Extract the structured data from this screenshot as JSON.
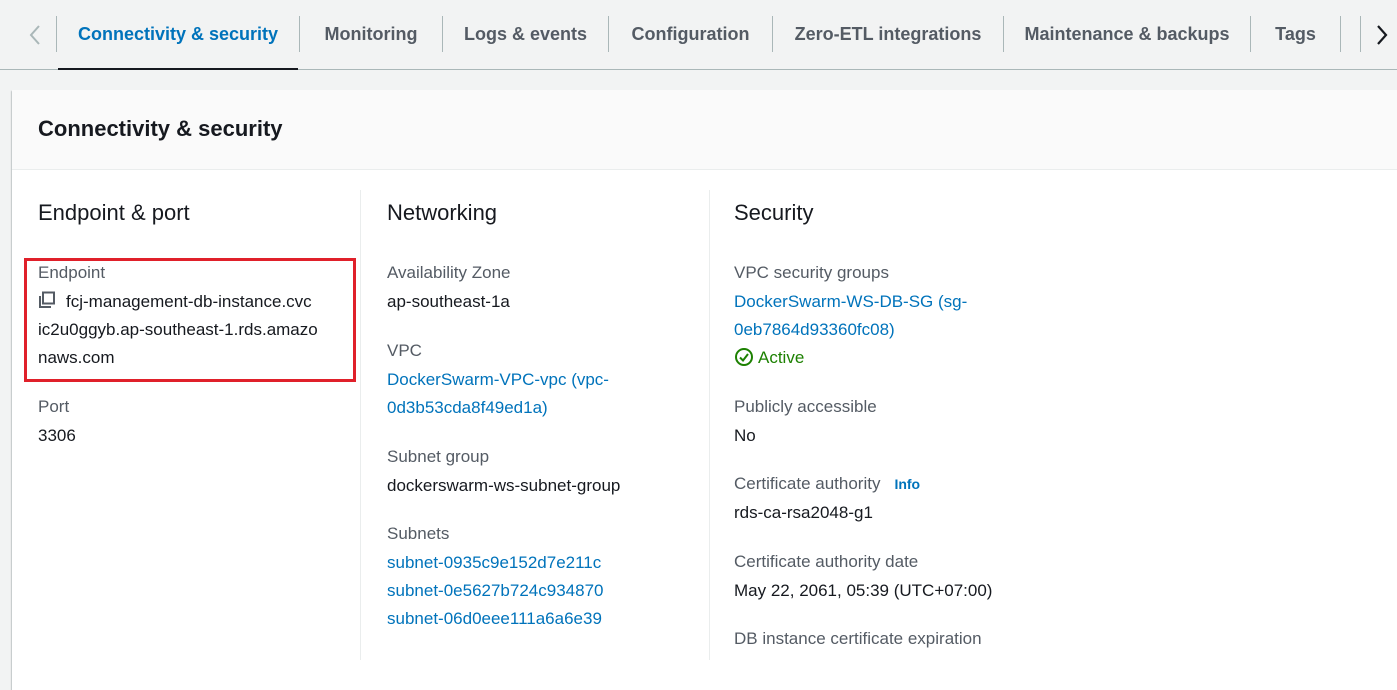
{
  "tabs": {
    "items": [
      {
        "label": "Connectivity & security"
      },
      {
        "label": "Monitoring"
      },
      {
        "label": "Logs & events"
      },
      {
        "label": "Configuration"
      },
      {
        "label": "Zero-ETL integrations"
      },
      {
        "label": "Maintenance & backups"
      },
      {
        "label": "Tags"
      }
    ],
    "active_index": 0
  },
  "panel": {
    "title": "Connectivity & security",
    "endpoint_port": {
      "title": "Endpoint & port",
      "endpoint_label": "Endpoint",
      "endpoint_line1": "fcj-management-db-instance.cvc",
      "endpoint_line2": "ic2u0ggyb.ap-southeast-1.rds.amazo",
      "endpoint_line3": "naws.com",
      "port_label": "Port",
      "port_value": "3306"
    },
    "networking": {
      "title": "Networking",
      "az_label": "Availability Zone",
      "az_value": "ap-southeast-1a",
      "vpc_label": "VPC",
      "vpc_line1": "DockerSwarm-VPC-vpc (vpc-",
      "vpc_line2": "0d3b53cda8f49ed1a)",
      "subnet_group_label": "Subnet group",
      "subnet_group_value": "dockerswarm-ws-subnet-group",
      "subnets_label": "Subnets",
      "subnets": [
        "subnet-0935c9e152d7e211c",
        "subnet-0e5627b724c934870",
        "subnet-06d0eee111a6a6e39"
      ]
    },
    "security": {
      "title": "Security",
      "sg_label": "VPC security groups",
      "sg_line1": "DockerSwarm-WS-DB-SG (sg-",
      "sg_line2": "0eb7864d93360fc08)",
      "sg_status": "Active",
      "public_label": "Publicly accessible",
      "public_value": "No",
      "ca_label": "Certificate authority",
      "ca_info": "Info",
      "ca_value": "rds-ca-rsa2048-g1",
      "ca_date_label": "Certificate authority date",
      "ca_date_value": "May 22, 2061, 05:39 (UTC+07:00)",
      "cert_exp_label": "DB instance certificate expiration"
    }
  },
  "colors": {
    "accent": "#0073bb",
    "active_status": "#1d8102",
    "highlight_border": "#e0202a"
  }
}
